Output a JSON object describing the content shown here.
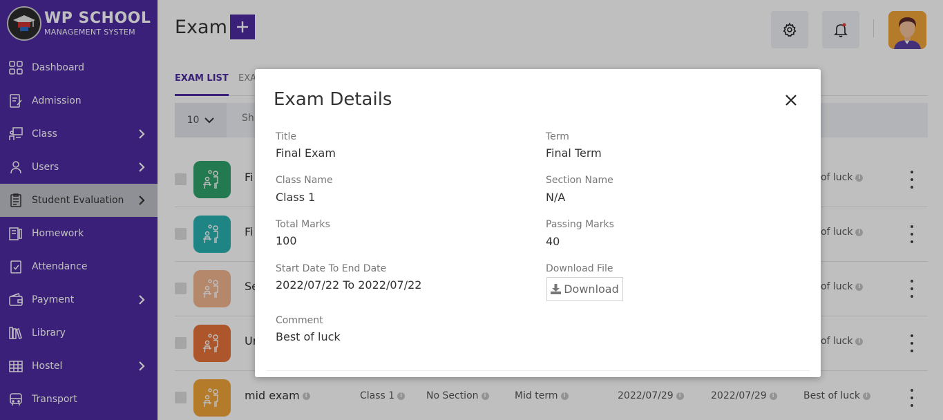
{
  "brand": {
    "line1": "WP SCHOOL",
    "line2": "MANAGEMENT SYSTEM"
  },
  "sidebar": {
    "items": [
      {
        "label": "Dashboard"
      },
      {
        "label": "Admission"
      },
      {
        "label": "Class"
      },
      {
        "label": "Users"
      },
      {
        "label": "Student Evaluation"
      },
      {
        "label": "Homework"
      },
      {
        "label": "Attendance"
      },
      {
        "label": "Payment"
      },
      {
        "label": "Library"
      },
      {
        "label": "Hostel"
      },
      {
        "label": "Transport"
      }
    ]
  },
  "header": {
    "title": "Exam",
    "add_symbol": "+"
  },
  "tabs": [
    {
      "label": "EXAM LIST"
    },
    {
      "label": "EXA"
    }
  ],
  "toolbar": {
    "per_page": "10",
    "show_text": "Sh"
  },
  "rows": [
    {
      "name": "Fi",
      "comment": "t of luck",
      "color": "#2fa36b"
    },
    {
      "name": "Fi",
      "comment": "t of luck",
      "color": "#2ab0b0"
    },
    {
      "name": "Se",
      "comment": "t of luck",
      "color": "#f2b58f"
    },
    {
      "name": "Ur",
      "comment": "t of luck",
      "color": "#e8733a"
    },
    {
      "name": "mid exam",
      "class": "Class 1",
      "section": "No Section",
      "term": "Mid term",
      "start": "2022/07/29",
      "end": "2022/07/29",
      "comment": "Best of luck",
      "color": "#f1a43a"
    }
  ],
  "modal": {
    "title": "Exam Details",
    "fields": {
      "title": {
        "label": "Title",
        "value": "Final Exam"
      },
      "term": {
        "label": "Term",
        "value": "Final Term"
      },
      "class_name": {
        "label": "Class Name",
        "value": "Class 1"
      },
      "section_name": {
        "label": "Section Name",
        "value": "N/A"
      },
      "total_marks": {
        "label": "Total Marks",
        "value": "100"
      },
      "passing_marks": {
        "label": "Passing Marks",
        "value": "40"
      },
      "date_range": {
        "label": "Start Date To End Date",
        "value": "2022/07/22 To 2022/07/22"
      },
      "download_file": {
        "label": "Download File",
        "button": "Download"
      },
      "comment": {
        "label": "Comment",
        "value": "Best of luck"
      }
    }
  },
  "colors": {
    "primary": "#4f2ba3",
    "active_nav": "#bfc1c9"
  },
  "icons": [
    "dashboard-icon",
    "admission-icon",
    "class-icon",
    "users-icon",
    "evaluation-icon",
    "homework-icon",
    "attendance-icon",
    "payment-icon",
    "library-icon",
    "hostel-icon",
    "transport-icon",
    "gear-icon",
    "bell-icon",
    "close-icon",
    "download-icon",
    "info-icon",
    "kebab-icon"
  ]
}
